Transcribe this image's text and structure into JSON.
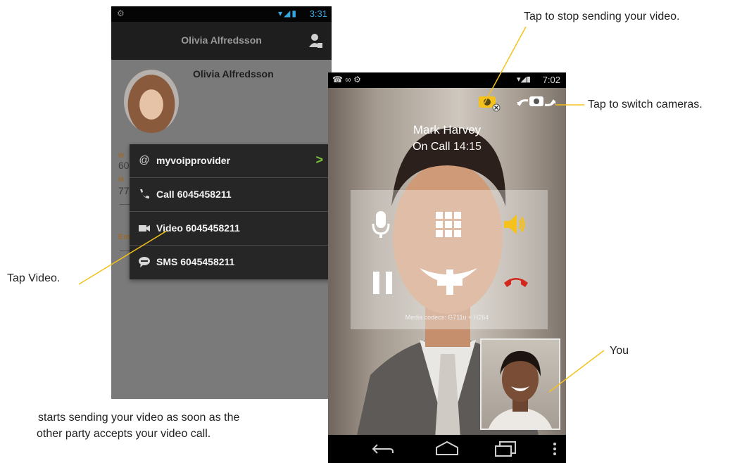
{
  "phone1": {
    "status": {
      "time": "3:31"
    },
    "header": {
      "title": "Olivia Alfredsson"
    },
    "contact": {
      "name": "Olivia Alfredsson",
      "fragments": [
        "60",
        "77",
        "Em",
        "W",
        "M"
      ]
    },
    "menu": {
      "items": [
        {
          "icon": "at-icon",
          "label": "myvoipprovider",
          "chevron": true
        },
        {
          "icon": "phone-icon",
          "label": "Call 6045458211"
        },
        {
          "icon": "video-icon",
          "label": "Video 6045458211"
        },
        {
          "icon": "sms-icon",
          "label": "SMS 6045458211"
        }
      ]
    }
  },
  "phone2": {
    "status": {
      "time": "7:02"
    },
    "caller": {
      "name": "Mark Harvey",
      "state": "On Call",
      "duration": "14:15"
    },
    "codecs": "Media codecs: G711u + H264",
    "controls": [
      "microphone-icon",
      "keypad-icon",
      "speaker-icon",
      "hold-icon",
      "add-call-icon",
      "end-call-icon"
    ],
    "toolbar": [
      "stop-video-icon",
      "switch-camera-icon"
    ],
    "nav": [
      "back-icon",
      "home-icon",
      "recent-apps-icon",
      "overflow-menu-icon"
    ]
  },
  "annotations": {
    "stop_video": "Tap to stop sending your video.",
    "switch_cameras": "Tap to switch cameras.",
    "tap_video": "Tap Video.",
    "you": "You",
    "caption_line1": "starts sending your video as soon as the",
    "caption_line2": "other party accepts your video call."
  },
  "colors": {
    "accent_yellow": "#f4c21b",
    "status_blue": "#36a6e0",
    "chevron_green": "#7dc23a",
    "end_call_red": "#d4261c"
  }
}
